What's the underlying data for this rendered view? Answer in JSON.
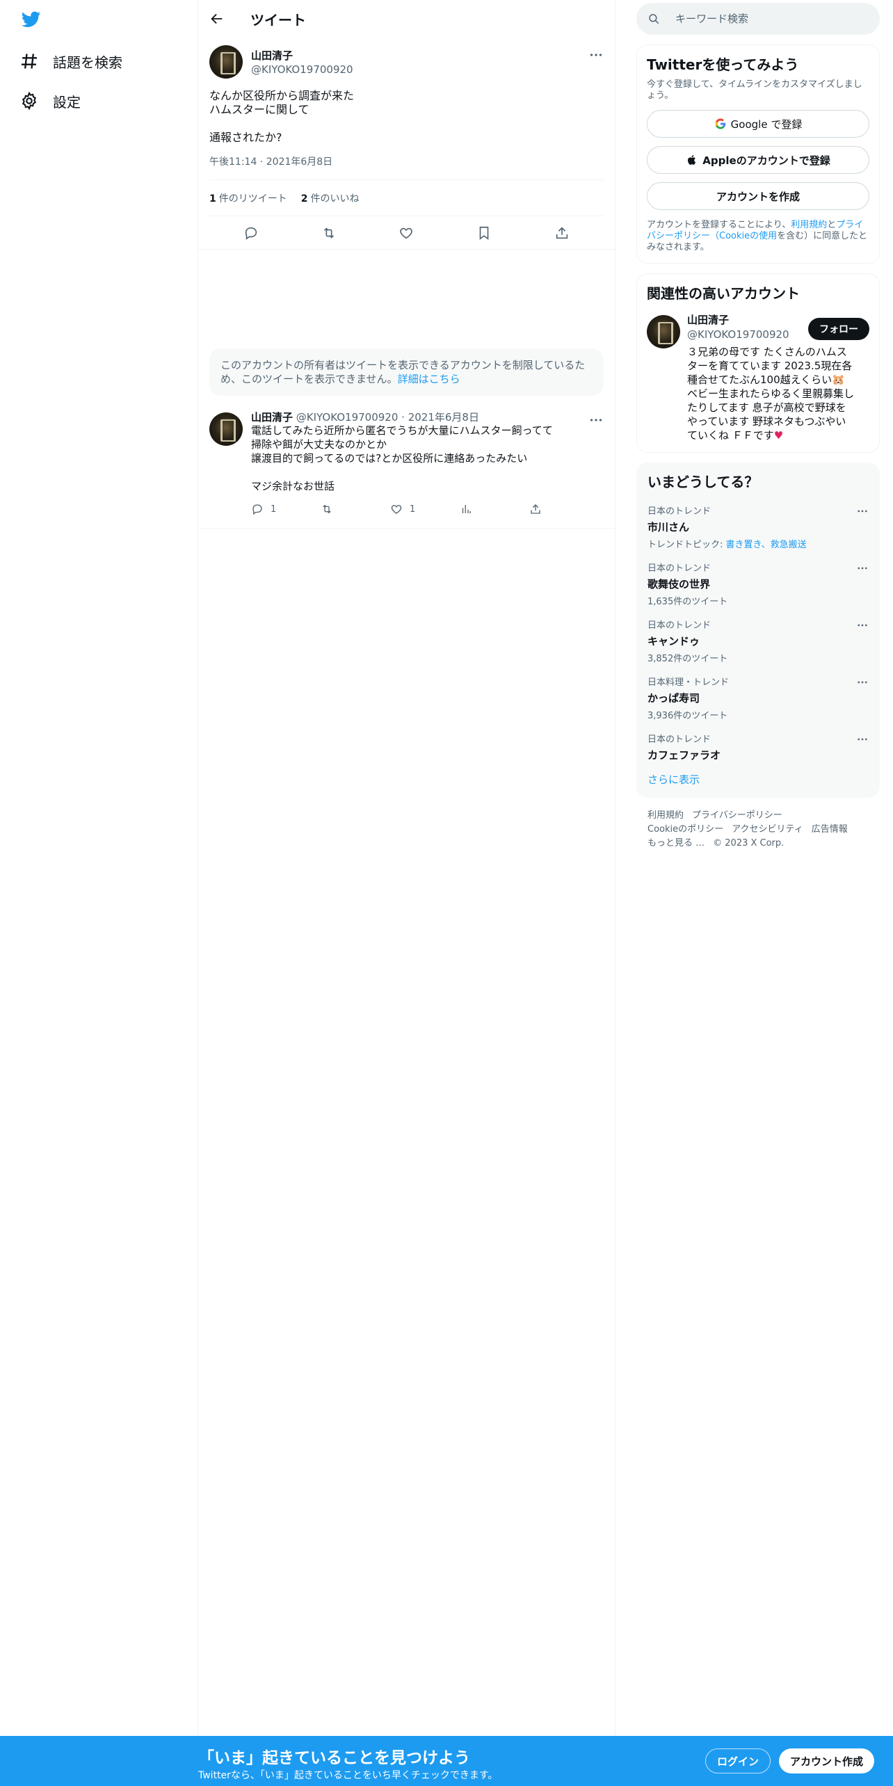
{
  "nav": {
    "items": [
      {
        "label": "話題を検索",
        "icon": "hashtag-icon"
      },
      {
        "label": "設定",
        "icon": "gear-icon"
      }
    ]
  },
  "header": {
    "title": "ツイート"
  },
  "tweet": {
    "name": "山田清子",
    "handle": "@KIYOKO19700920",
    "text": "なんか区役所から調査が来た\nハムスターに関して\n\n通報されたか?",
    "time": "午後11:14",
    "date": "2021年6月8日",
    "retweets": "1",
    "retweets_label": "件のリツイート",
    "likes": "2",
    "likes_label": "件のいいね"
  },
  "restricted": {
    "text": "このアカウントの所有者はツイートを表示できるアカウントを制限しているため、このツイートを表示できません。",
    "link": "詳細はこちら"
  },
  "reply": {
    "name": "山田清子",
    "handle": "@KIYOKO19700920",
    "date": "2021年6月8日",
    "text": "電話してみたら近所から匿名でうちが大量にハムスター飼ってて\n掃除や餌が大丈夫なのかとか\n譲渡目的で飼ってるのでは?とか区役所に連絡あったみたい\n\nマジ余計なお世話",
    "replies": "1",
    "likes": "1"
  },
  "search": {
    "placeholder": "キーワード検索"
  },
  "signup": {
    "title": "Twitterを使ってみよう",
    "subtitle": "今すぐ登録して、タイムラインをカスタマイズしましょう。",
    "google": "Google で登録",
    "apple": "Appleのアカウントで登録",
    "create": "アカウントを作成",
    "legal_pre": "アカウントを登録することにより、",
    "legal_terms": "利用規約",
    "legal_and": "と",
    "legal_privacy": "プライバシーポリシー（Cookieの使用",
    "legal_post": "を含む）に同意したとみなされます。"
  },
  "related": {
    "title": "関連性の高いアカウント",
    "name": "山田清子",
    "handle": "@KIYOKO19700920",
    "follow": "フォロー",
    "bio": "３兄弟の母です たくさんのハムスターを育てています 2023.5現在各種合せてたぶん100越えくらい🐹 ベビー生まれたらゆるく里親募集したりしてます 息子が高校で野球をやっています 野球ネタもつぶやいていくね ＦＦです",
    "bio_heart": "♥"
  },
  "trends": {
    "title": "いまどうしてる？",
    "items": [
      {
        "category": "日本のトレンド",
        "name": "市川さん",
        "detail_prefix": "トレンドトピック: ",
        "detail_links": "書き置き、救急搬送"
      },
      {
        "category": "日本のトレンド",
        "name": "歌舞伎の世界",
        "count": "1,635件のツイート"
      },
      {
        "category": "日本のトレンド",
        "name": "キャンドゥ",
        "count": "3,852件のツイート"
      },
      {
        "category": "日本料理・トレンド",
        "name": "かっぱ寿司",
        "count": "3,936件のツイート"
      },
      {
        "category": "日本のトレンド",
        "name": "カフェファラオ",
        "count": ""
      }
    ],
    "show_more": "さらに表示"
  },
  "footer": {
    "links": [
      "利用規約",
      "プライバシーポリシー",
      "Cookieのポリシー",
      "アクセシビリティ",
      "広告情報",
      "もっと見る …",
      "© 2023 X Corp."
    ]
  },
  "banner": {
    "title": "「いま」起きていることを見つけよう",
    "subtitle": "Twitterなら、「いま」起きていることをいち早くチェックできます。",
    "login": "ログイン",
    "signup": "アカウント作成"
  },
  "colors": {
    "accent": "#1d9bf0",
    "text": "#0f1419",
    "muted": "#536471"
  }
}
